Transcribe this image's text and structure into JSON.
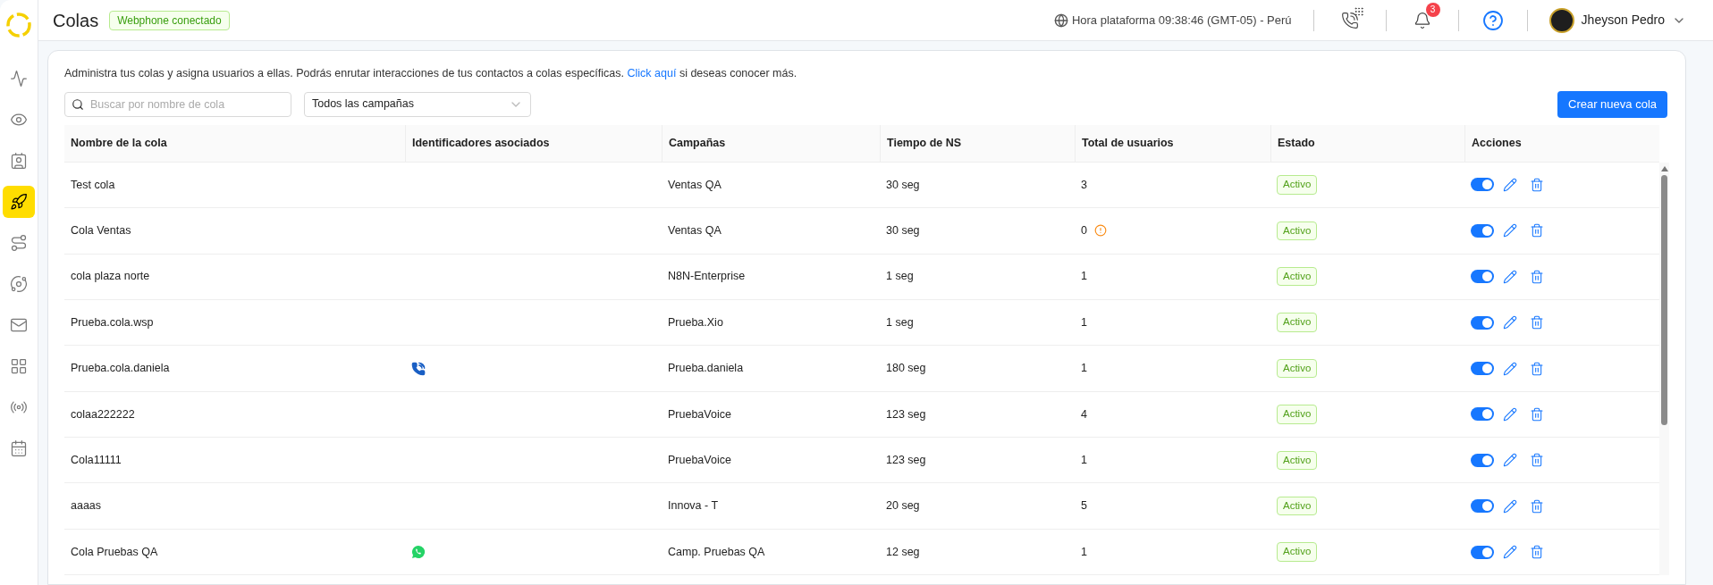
{
  "sidebar": {
    "items": [
      {
        "kind": "activity",
        "selected": false
      },
      {
        "kind": "eye",
        "selected": false
      },
      {
        "kind": "contact",
        "selected": false
      },
      {
        "kind": "rocket",
        "selected": true
      },
      {
        "kind": "route",
        "selected": false
      },
      {
        "kind": "planet",
        "selected": false
      },
      {
        "kind": "mail",
        "selected": false
      },
      {
        "kind": "apps",
        "selected": false
      },
      {
        "kind": "broadcast",
        "selected": false
      },
      {
        "kind": "calendar",
        "selected": false
      }
    ]
  },
  "header": {
    "title": "Colas",
    "webphone_badge": "Webphone conectado",
    "platform_time": "Hora plataforma 09:38:46 (GMT-05) - Perú",
    "notifications_count": "3",
    "user_name": "Jheyson Pedro"
  },
  "intro": {
    "text": "Administra tus colas y asigna usuarios a ellas. Podrás enrutar interacciones de tus contactos a colas específicas.",
    "link": "Click aquí",
    "after_link": "si deseas conocer más."
  },
  "search": {
    "placeholder": "Buscar por nombre de cola"
  },
  "campaign_filter": {
    "value": "Todos las campañas"
  },
  "create_button": "Crear nueva cola",
  "table": {
    "columns": [
      "Nombre de la cola",
      "Identificadores asociados",
      "Campañas",
      "Tiempo de NS",
      "Total de usuarios",
      "Estado",
      "Acciones"
    ],
    "rows": [
      {
        "name": "Test cola",
        "campaign": "Ventas QA",
        "ns_time": "30 seg",
        "users": "3",
        "warning": false,
        "status": "Activo",
        "on": true
      },
      {
        "name": "Cola Ventas",
        "campaign": "Ventas QA",
        "ns_time": "30 seg",
        "users": "0",
        "warning": true,
        "status": "Activo",
        "on": true
      },
      {
        "name": "cola plaza norte",
        "campaign": "N8N-Enterprise",
        "ns_time": "1 seg",
        "users": "1",
        "warning": false,
        "status": "Activo",
        "on": true
      },
      {
        "name": "Prueba.cola.wsp",
        "campaign": "Prueba.Xio",
        "ns_time": "1 seg",
        "users": "1",
        "warning": false,
        "status": "Activo",
        "on": true
      },
      {
        "name": "Prueba.cola.daniela",
        "identifiers": [
          {
            "kind": "phone"
          }
        ],
        "campaign": "Prueba.daniela",
        "ns_time": "180 seg",
        "users": "1",
        "warning": false,
        "status": "Activo",
        "on": true
      },
      {
        "name": "colaa222222",
        "campaign": "PruebaVoice",
        "ns_time": "123 seg",
        "users": "4",
        "warning": false,
        "status": "Activo",
        "on": true
      },
      {
        "name": "Cola11111",
        "campaign": "PruebaVoice",
        "ns_time": "123 seg",
        "users": "1",
        "warning": false,
        "status": "Activo",
        "on": true
      },
      {
        "name": "aaaas",
        "campaign": "Innova - T",
        "ns_time": "20 seg",
        "users": "5",
        "warning": false,
        "status": "Activo",
        "on": true
      },
      {
        "name": "Cola Pruebas QA",
        "identifiers": [
          {
            "kind": "whatsapp"
          }
        ],
        "campaign": "Camp. Pruebas QA",
        "ns_time": "12 seg",
        "users": "1",
        "warning": false,
        "status": "Activo",
        "on": true
      }
    ]
  }
}
